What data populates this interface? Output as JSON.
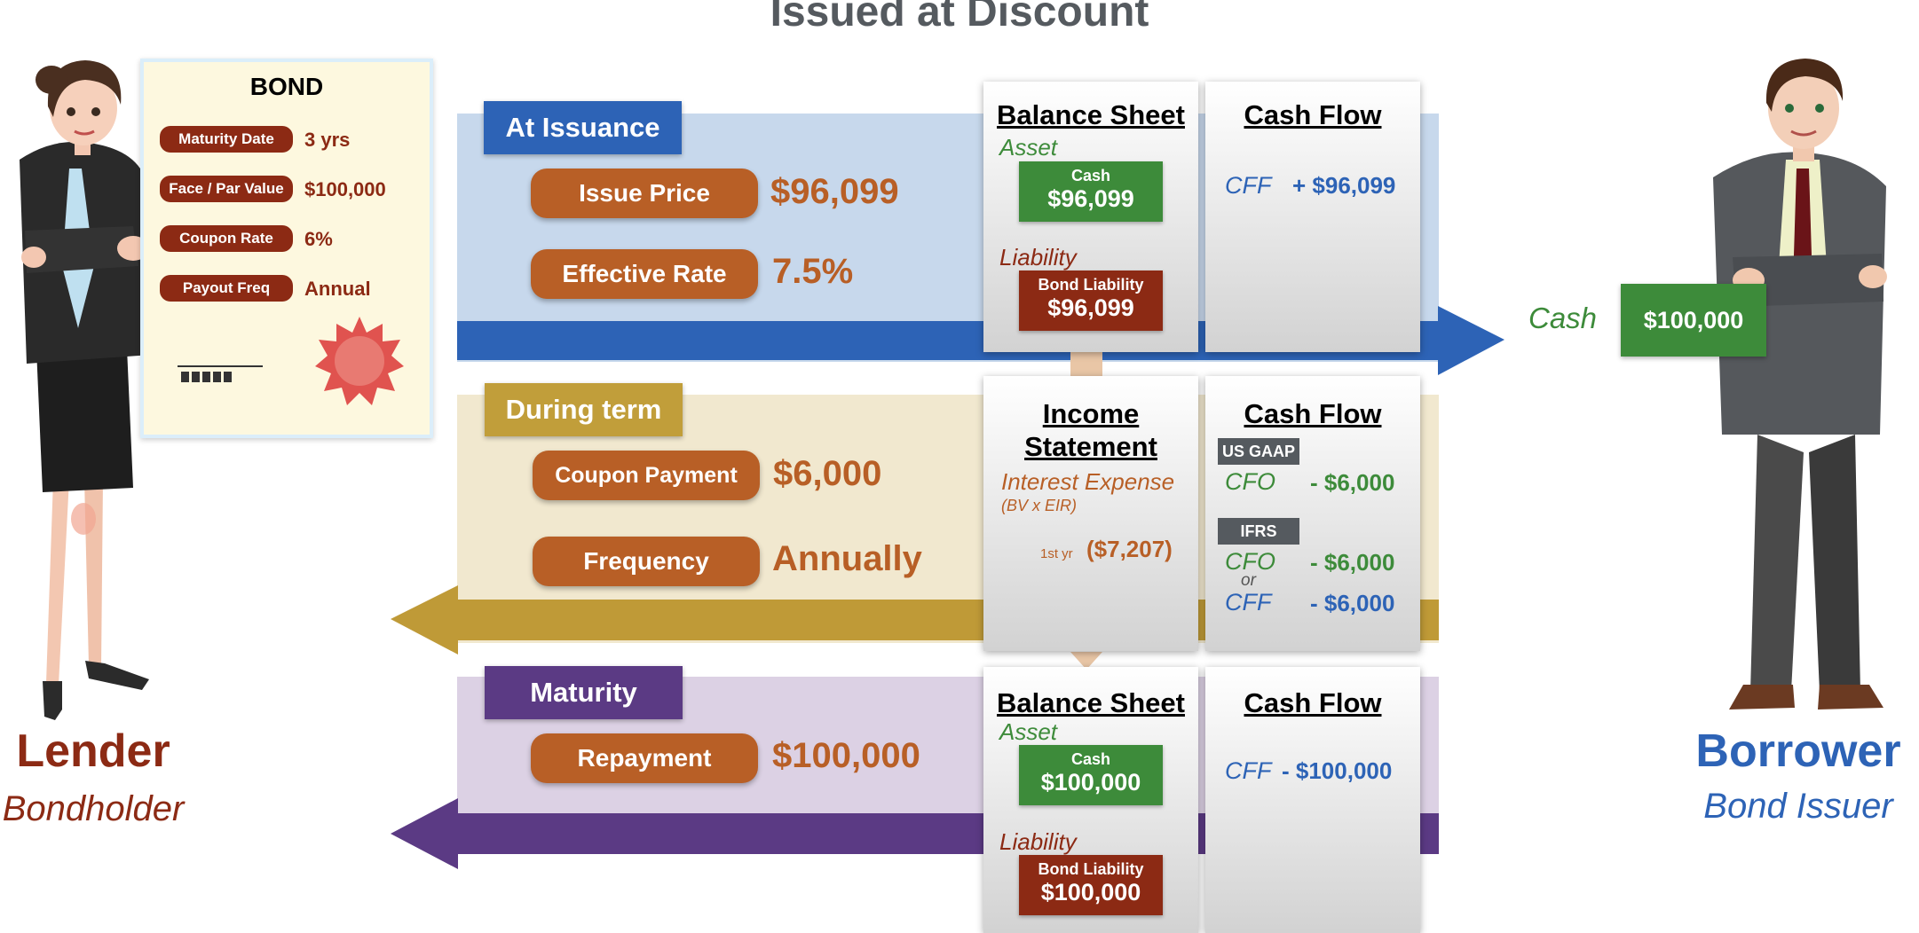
{
  "title": "Issued at Discount",
  "bond": {
    "heading": "BOND",
    "rows": [
      {
        "label": "Maturity Date",
        "value": "3 yrs"
      },
      {
        "label": "Face / Par Value",
        "value": "$100,000"
      },
      {
        "label": "Coupon Rate",
        "value": "6%"
      },
      {
        "label": "Payout Freq",
        "value": "Annual"
      }
    ]
  },
  "lender": {
    "name": "Lender",
    "role": "Bondholder"
  },
  "borrower": {
    "name": "Borrower",
    "role": "Bond Issuer",
    "cash_label": "Cash",
    "cash_value": "$100,000"
  },
  "issuance": {
    "header": "At Issuance",
    "items": [
      {
        "label": "Issue Price",
        "value": "$96,099"
      },
      {
        "label": "Effective Rate",
        "value": "7.5%"
      }
    ],
    "balance_sheet": {
      "title": "Balance Sheet",
      "asset_label": "Asset",
      "asset_box_label": "Cash",
      "asset_box_value": "$96,099",
      "liability_label": "Liability",
      "liability_box_label": "Bond Liability",
      "liability_box_value": "$96,099"
    },
    "cash_flow": {
      "title": "Cash Flow",
      "category": "CFF",
      "amount": "+ $96,099"
    }
  },
  "term": {
    "header": "During term",
    "items": [
      {
        "label": "Coupon Payment",
        "value": "$6,000"
      },
      {
        "label": "Frequency",
        "value": "Annually"
      }
    ],
    "income_statement": {
      "title_line1": "Income",
      "title_line2": "Statement",
      "expense_label": "Interest Expense",
      "expense_note": "(BV x EIR)",
      "year_label": "1st yr",
      "year_value": "($7,207)"
    },
    "cash_flow": {
      "title": "Cash Flow",
      "us_gaap_badge": "US GAAP",
      "us_gaap_category": "CFO",
      "us_gaap_amount": "- $6,000",
      "ifrs_badge": "IFRS",
      "ifrs_cfo_category": "CFO",
      "ifrs_cfo_amount": "- $6,000",
      "or_label": "or",
      "ifrs_cff_category": "CFF",
      "ifrs_cff_amount": "- $6,000"
    }
  },
  "maturity": {
    "header": "Maturity",
    "items": [
      {
        "label": "Repayment",
        "value": "$100,000"
      }
    ],
    "balance_sheet": {
      "title": "Balance Sheet",
      "asset_label": "Asset",
      "asset_box_label": "Cash",
      "asset_box_value": "$100,000",
      "liability_label": "Liability",
      "liability_box_label": "Bond Liability",
      "liability_box_value": "$100,000"
    },
    "cash_flow": {
      "title": "Cash Flow",
      "category": "CFF",
      "amount": "- $100,000"
    }
  },
  "colors": {
    "issuance_band": "#c7d8ec",
    "issuance_arrow": "#2d63b6",
    "term_band": "#f1e8cf",
    "term_arrow": "#bf9a37",
    "term_header": "#c19e3a",
    "maturity_band": "#dcd1e4",
    "maturity_arrow": "#5b3a84",
    "orange": "#b85f26",
    "green": "#3d8b3a",
    "dark_red": "#8c2a14",
    "blue": "#2d63b6"
  }
}
